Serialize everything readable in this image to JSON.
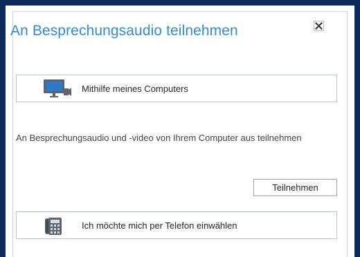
{
  "dialog": {
    "title": "An Besprechungsaudio teilnehmen",
    "close_icon": "close-icon"
  },
  "options": {
    "computer": {
      "label": "Mithilfe meines Computers",
      "icon": "monitor-camera-icon"
    },
    "phone": {
      "label": "Ich möchte mich per Telefon einwählen",
      "icon": "desk-phone-icon"
    }
  },
  "description": "An Besprechungsaudio und -video von Ihrem Computer aus teilnehmen",
  "join_button": {
    "label": "Teilnehmen"
  },
  "colors": {
    "frame": "#0d2a5c",
    "title": "#2c8ed6",
    "option_border": "#a9c7e2",
    "icon_gray": "#5a6470",
    "monitor_screen": "#2e78c7"
  }
}
